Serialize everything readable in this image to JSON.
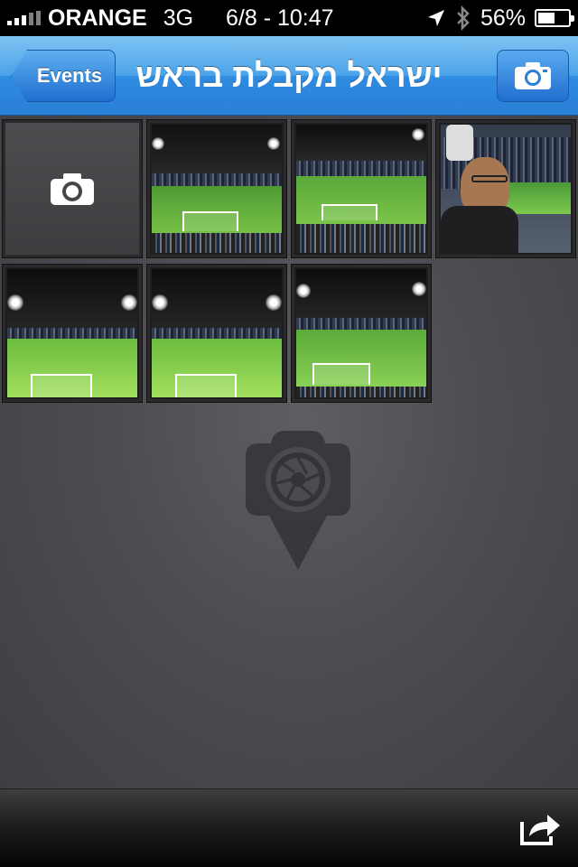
{
  "status_bar": {
    "carrier": "ORANGE",
    "network": "3G",
    "datetime": "6/8 - 10:47",
    "battery_percent": "56%",
    "battery_level": 0.56,
    "icons": [
      "signal-bars-icon",
      "location-arrow-icon",
      "bluetooth-icon",
      "battery-icon"
    ]
  },
  "nav_bar": {
    "back_label": "Events",
    "title": "ישראל מקבלת בראש",
    "right_button_icon": "camera-icon"
  },
  "grid": {
    "add_tile_icon": "camera-icon",
    "photos": [
      {
        "subject": "stadium-night-field"
      },
      {
        "subject": "stadium-night-field"
      },
      {
        "subject": "person-in-stands"
      },
      {
        "subject": "stadium-night-field"
      },
      {
        "subject": "stadium-night-field"
      },
      {
        "subject": "stadium-night-field"
      }
    ]
  },
  "background_logo_icon": "camera-pin-logo-icon",
  "toolbar": {
    "share_icon": "share-icon"
  },
  "colors": {
    "nav_blue": "#2f8ce0",
    "field_green": "#7fd14a",
    "background": "#4a4a50"
  }
}
